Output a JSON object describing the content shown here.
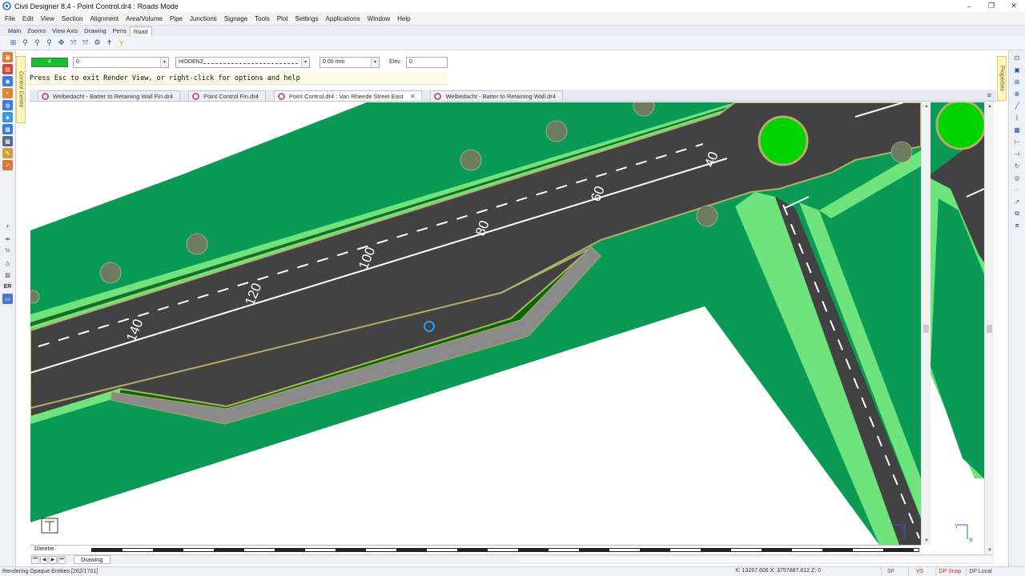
{
  "window": {
    "title": "Civil Designer 8.4 - Point Control.dr4 : Roads Mode",
    "minimize": "–",
    "restore": "❐",
    "close": "✕"
  },
  "menu": [
    "File",
    "Edit",
    "View",
    "Section",
    "Alignment",
    "Area/Volume",
    "Pipe",
    "Junctions",
    "Signage",
    "Tools",
    "Plot",
    "Settings",
    "Applications",
    "Window",
    "Help"
  ],
  "ribbon_tabs": [
    {
      "label": "Main",
      "active": false
    },
    {
      "label": "Zooms",
      "active": false
    },
    {
      "label": "View Axis",
      "active": false
    },
    {
      "label": "Drawing",
      "active": false
    },
    {
      "label": "Pens",
      "active": false
    },
    {
      "label": "Road",
      "active": true
    }
  ],
  "properties": {
    "colour_value": "4",
    "layer_value": "0",
    "linetype_value": "HIDDEN2",
    "width_value": "0.00 mm",
    "elev_label": "Elev.",
    "elev_value": "0"
  },
  "command_prompt": "Press Esc to exit Render View, or right-click for options and help",
  "side_tabs": {
    "left": "Control Centre",
    "right": "Properties"
  },
  "document_tabs": [
    {
      "label": "Welbedacht - Batter to Retaining Wall Fin.dr4",
      "active": false
    },
    {
      "label": "Point Control Fin.dr4",
      "active": false
    },
    {
      "label": "Point Control.dr4 : Van Rheede Street East",
      "active": true
    },
    {
      "label": "Welbedacht - Batter to Retaining Wall.dr4",
      "active": false
    }
  ],
  "canvas": {
    "chainages": [
      "140",
      "120",
      "100",
      "80",
      "60",
      "40"
    ],
    "colors": {
      "verge": "#0b9a56",
      "road": "#424242",
      "kerb": "#6fe37c",
      "dark_green": "#006a00",
      "wall": "#8a8a8a",
      "circle": "#00d400",
      "background": "#ffffff"
    },
    "ucs_y": "Y",
    "ucs_x": "X"
  },
  "scale_label": "10metre",
  "sheet_tab": "Drawing",
  "status": {
    "message": "Rendering Opaque Entities [262/1701]",
    "coords": "X: 13267.606 X: 3757887.812 Z: 0",
    "buttons": [
      "SF",
      "VS",
      "DP Snap",
      "DP Local"
    ]
  }
}
